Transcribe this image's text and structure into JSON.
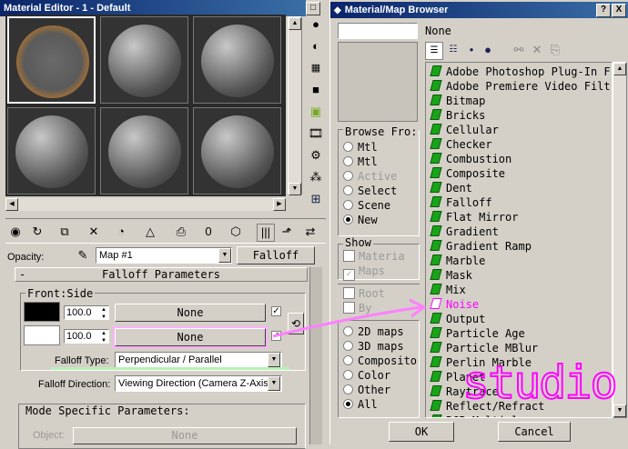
{
  "material_editor": {
    "title": "Material Editor - 1 - Default",
    "opacity_label": "Opacity:",
    "map_name": "Map #1",
    "map_type_button": "Falloff",
    "rollout_title": "Falloff Parameters",
    "rollout_minus": "-",
    "front_side_label": "Front:Side",
    "spinner1": "100.0",
    "spinner2": "100.0",
    "none1": "None",
    "none2": "None",
    "falloff_type_label": "Falloff Type:",
    "falloff_type_value": "Perpendicular / Parallel",
    "falloff_direction_label": "Falloff Direction:",
    "falloff_direction_value": "Viewing Direction (Camera Z-Axis)",
    "mode_specific_title": "Mode Specific Parameters:",
    "object_label": "Object:",
    "object_value": "None"
  },
  "browser": {
    "title": "Material/Map Browser",
    "help_btn": "?",
    "close_btn": "X",
    "search_value": "None",
    "browse_from_label": "Browse Fro:",
    "browse_from_options": [
      "Mtl",
      "Mtl",
      "Active",
      "Select",
      "Scene",
      "New"
    ],
    "browse_from_selected": 5,
    "show_label": "Show",
    "show_options": [
      "Materia",
      "Maps"
    ],
    "root_label": "Root",
    "by_label": "By",
    "map_filter_options": [
      "2D maps",
      "3D maps",
      "Composito",
      "Color",
      "Other",
      "All"
    ],
    "map_filter_selected": 5,
    "list_items": [
      "Adobe Photoshop Plug-In F",
      "Adobe Premiere Video Filt",
      "Bitmap",
      "Bricks",
      "Cellular",
      "Checker",
      "Combustion",
      "Composite",
      "Dent",
      "Falloff",
      "Flat Mirror",
      "Gradient",
      "Gradient Ramp",
      "Marble",
      "Mask",
      "Mix",
      "Noise",
      "Output",
      "Particle Age",
      "Particle MBlur",
      "Perlin Marble",
      "Planet",
      "Raytrace",
      "Reflect/Refract",
      "RGB Multiply"
    ],
    "highlight_item": "Noise",
    "ok_button": "OK",
    "cancel_button": "Cancel"
  },
  "overlay": {
    "watermark": "studio",
    "accent_color": "#ff00ff",
    "highlight_color": "#ccffcc"
  }
}
